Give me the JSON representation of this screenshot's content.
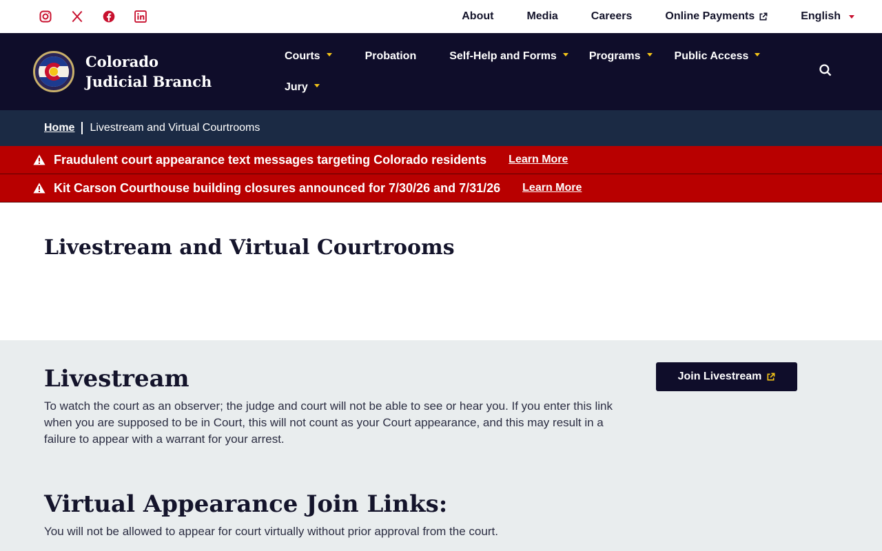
{
  "utility": {
    "social": [
      {
        "name": "instagram-icon"
      },
      {
        "name": "x-icon"
      },
      {
        "name": "facebook-icon"
      },
      {
        "name": "linkedin-icon"
      }
    ],
    "links": {
      "about": "About",
      "media": "Media",
      "careers": "Careers",
      "online_payments": "Online Payments",
      "language": "English"
    },
    "accent_color": "#c8102e"
  },
  "header": {
    "brand_name": "Colorado Judicial Branch",
    "nav": {
      "courts": "Courts",
      "probation": "Probation",
      "self_help": "Self-Help and Forms",
      "programs": "Programs",
      "public_access": "Public Access",
      "jury": "Jury"
    },
    "background_color": "#0f0d2a",
    "caret_color": "#f5c518"
  },
  "breadcrumb": {
    "home": "Home",
    "current": "Livestream and Virtual Courtrooms"
  },
  "alerts": [
    {
      "message": "Fraudulent court appearance text messages targeting Colorado residents",
      "link": "Learn More"
    },
    {
      "message": "Kit Carson Courthouse building closures announced for 7/30/26 and 7/31/26",
      "link": "Learn More"
    }
  ],
  "alert_color": "#b80000",
  "page": {
    "title": "Livestream and Virtual Courtrooms"
  },
  "livestream": {
    "heading": "Livestream",
    "text": "To watch the court as an observer; the judge and court will not be able to see or hear you. If you enter this link when you are supposed to be in Court, this will not count as your Court appearance, and this may result in a failure to appear with a warrant for your arrest.",
    "button": "Join Livestream"
  },
  "virtual": {
    "heading": "Virtual Appearance Join Links:",
    "text": "You will not be allowed to appear for court virtually without prior approval from the court."
  }
}
